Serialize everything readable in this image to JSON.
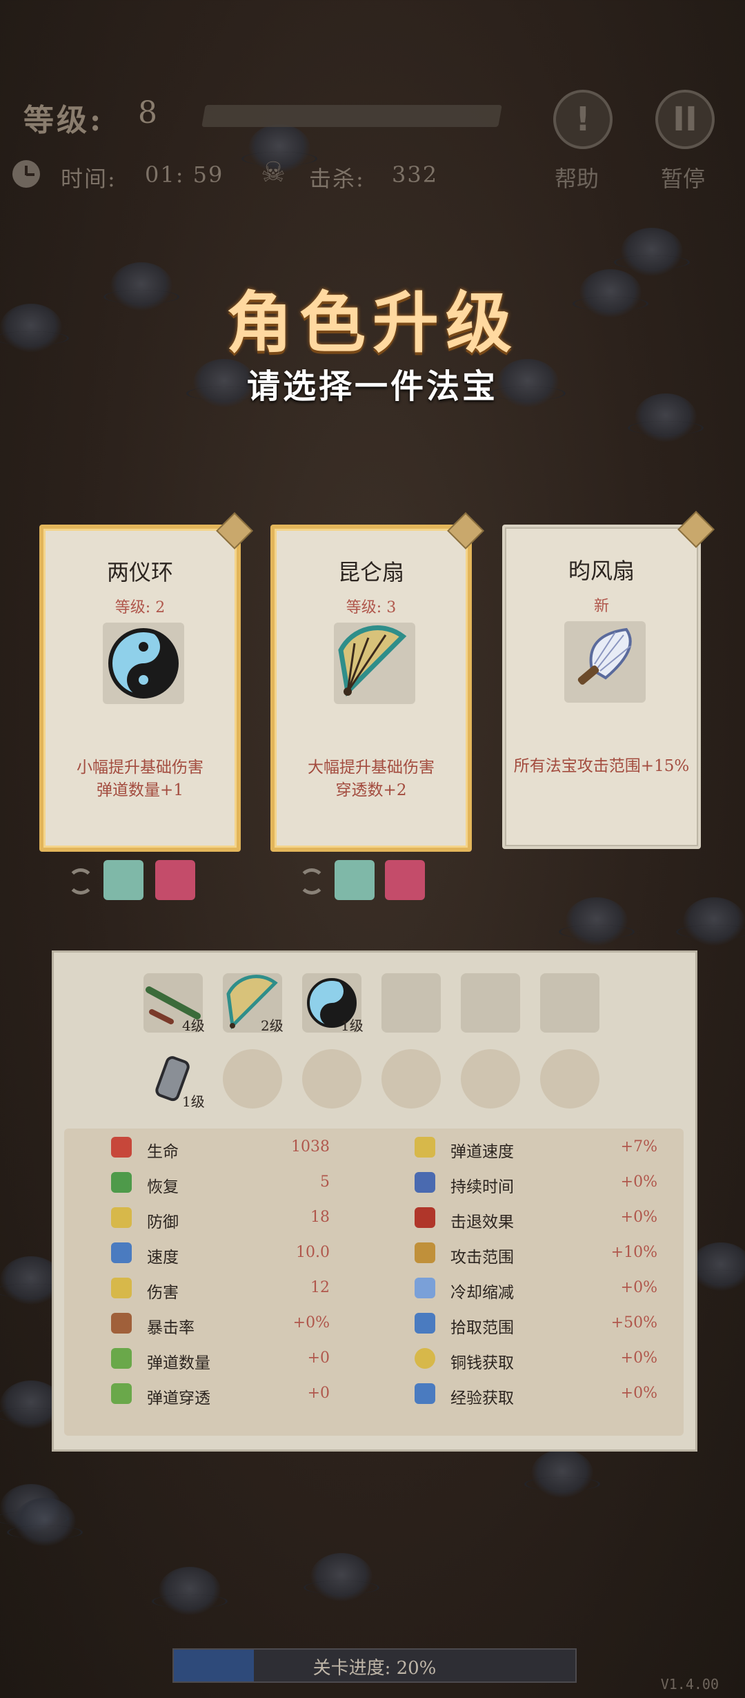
{
  "hud": {
    "level_label": "等级:",
    "level_value": "8",
    "time_label": "时间:",
    "time_value": "01: 59",
    "kills_label": "击杀:",
    "kills_value": "332",
    "help_label": "帮助",
    "pause_label": "暂停"
  },
  "dialog": {
    "title": "角色升级",
    "subtitle": "请选择一件法宝"
  },
  "cards": [
    {
      "name": "两仪环",
      "level": "等级: 2",
      "desc": "小幅提升基础伤害\n弹道数量+1",
      "icon": "yin-yang-icon"
    },
    {
      "name": "昆仑扇",
      "level": "等级: 3",
      "desc": "大幅提升基础伤害\n穿透数+2",
      "icon": "folding-fan-icon"
    },
    {
      "name": "昀风扇",
      "level": "新",
      "desc": "所有法宝攻击范围+15%",
      "icon": "feather-fan-icon"
    }
  ],
  "inventory": {
    "weapons": [
      {
        "icon": "flute-icon",
        "level": "4级"
      },
      {
        "icon": "folding-fan-icon",
        "level": "2级"
      },
      {
        "icon": "yin-yang-icon",
        "level": "1级"
      }
    ],
    "passives": [
      {
        "icon": "bracer-icon",
        "level": "1级"
      }
    ]
  },
  "stats_left": [
    {
      "name": "生命",
      "value": "1038",
      "icon": "heart-icon"
    },
    {
      "name": "恢复",
      "value": "5",
      "icon": "plus-icon"
    },
    {
      "name": "防御",
      "value": "18",
      "icon": "shield-icon"
    },
    {
      "name": "速度",
      "value": "10.0",
      "icon": "speed-icon"
    },
    {
      "name": "伤害",
      "value": "12",
      "icon": "sword-icon"
    },
    {
      "name": "暴击率",
      "value": "+0%",
      "icon": "crit-icon"
    },
    {
      "name": "弹道数量",
      "value": "+0",
      "icon": "multishot-icon"
    },
    {
      "name": "弹道穿透",
      "value": "+0",
      "icon": "pierce-icon"
    }
  ],
  "stats_right": [
    {
      "name": "弹道速度",
      "value": "+7%",
      "icon": "projectile-speed-icon"
    },
    {
      "name": "持续时间",
      "value": "+0%",
      "icon": "hourglass-icon"
    },
    {
      "name": "击退效果",
      "value": "+0%",
      "icon": "fist-icon"
    },
    {
      "name": "攻击范围",
      "value": "+10%",
      "icon": "range-icon"
    },
    {
      "name": "冷却缩减",
      "value": "+0%",
      "icon": "cooldown-icon"
    },
    {
      "name": "拾取范围",
      "value": "+50%",
      "icon": "magnet-icon"
    },
    {
      "name": "铜钱获取",
      "value": "+0%",
      "icon": "coin-icon"
    },
    {
      "name": "经验获取",
      "value": "+0%",
      "icon": "book-icon"
    }
  ],
  "progress": {
    "label": "关卡进度: 20%",
    "value": 0.2
  },
  "version": "V1.4.00",
  "colors": {
    "title": "#ffd9a0",
    "accent_red": "#b0574c",
    "card_gold": "#e3b65b"
  }
}
